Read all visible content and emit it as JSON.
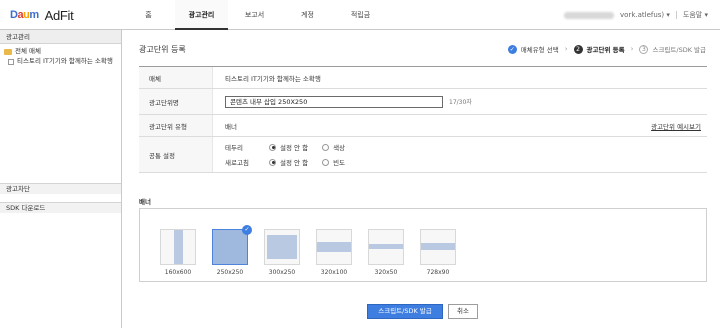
{
  "header": {
    "logo_daum": [
      "D",
      "a",
      "u",
      "m"
    ],
    "logo_adfit": "AdFit",
    "tabs": [
      {
        "label": "홈",
        "active": false
      },
      {
        "label": "광고관리",
        "active": true
      },
      {
        "label": "보고서",
        "active": false
      },
      {
        "label": "계정",
        "active": false
      },
      {
        "label": "적립금",
        "active": false
      }
    ],
    "user_suffix": "vork.atlefus)",
    "help": "도움말"
  },
  "sidebar": {
    "head": "광고관리",
    "tree_root": "전체 매체",
    "tree_child": "티스토리 IT기기와 함께하는 소확행",
    "bottom_items": [
      "광고차단",
      "SDK 다운로드"
    ]
  },
  "main": {
    "title": "광고단위 등록",
    "steps": [
      {
        "label": "매체유형 선택",
        "state": "done"
      },
      {
        "num": "2",
        "label": "광고단위 등록",
        "state": "current"
      },
      {
        "num": "3",
        "label": "스크립트/SDK 발급",
        "state": "todo"
      }
    ],
    "form": {
      "media_label": "매체",
      "media_value": "티스토리 IT기기와 함께하는 소확행",
      "unit_name_label": "광고단위명",
      "unit_name_value": "콘텐츠 내부 삽입 250X250",
      "unit_name_counter": "17/30자",
      "unit_type_label": "광고단위 유형",
      "unit_type_value": "배너",
      "unit_type_link": "광고단위 예시보기",
      "common_label": "공통 설정",
      "border_label": "테두리",
      "refresh_label": "새로고침",
      "border_options": [
        "설정 안 함",
        "색상"
      ],
      "refresh_options": [
        "설정 안 함",
        "빈도"
      ]
    },
    "banner_section_title": "배너",
    "banners": [
      {
        "label": "160x600",
        "selected": false
      },
      {
        "label": "250x250",
        "selected": true
      },
      {
        "label": "300x250",
        "selected": false
      },
      {
        "label": "320x100",
        "selected": false
      },
      {
        "label": "320x50",
        "selected": false
      },
      {
        "label": "728x90",
        "selected": false
      }
    ],
    "submit_label": "스크립트/SDK 발급",
    "cancel_label": "취소"
  },
  "colors": {
    "accent": "#3d7ee0",
    "folder": "#e9b949"
  }
}
